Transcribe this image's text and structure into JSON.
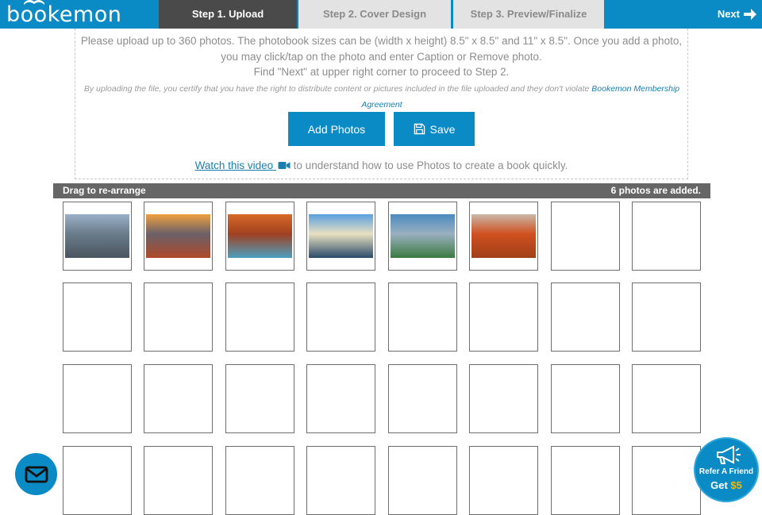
{
  "brand": {
    "logo_text": "bookemon"
  },
  "steps": [
    {
      "label": "Step 1. Upload",
      "active": true
    },
    {
      "label": "Step 2. Cover Design",
      "active": false
    },
    {
      "label": "Step 3. Preview/Finalize",
      "active": false
    }
  ],
  "next_label": "Next",
  "instructions": {
    "line1": "Please upload up to 360 photos. The photobook sizes can be (width x height) 8.5\" x 8.5\" and 11\" x 8.5\". Once you add a photo,",
    "line2": "you may click/tap on the photo and enter Caption or Remove photo.",
    "line3": "Find \"Next\" at upper right corner to proceed to Step 2.",
    "cert_text": "By uploading the file, you certify that you have the right to distribute content or pictures included in the file uploaded and they don't violate ",
    "cert_link_1": "Bookemon Membership",
    "cert_link_2": "Agreement"
  },
  "buttons": {
    "add_photos": "Add Photos",
    "save": "Save"
  },
  "video": {
    "link_text": "Watch this video",
    "rest": " to understand how to use Photos to create a book quickly."
  },
  "drag_bar": {
    "left": "Drag to re-arrange",
    "right": "6 photos are added."
  },
  "photos": [
    {
      "name": "lake-mountains",
      "colors": [
        "#9ab0c8",
        "#4a5560",
        "#6a7c8a"
      ]
    },
    {
      "name": "sunset-mountains",
      "colors": [
        "#f0a040",
        "#b04a2a",
        "#6a6068"
      ]
    },
    {
      "name": "winding-road",
      "colors": [
        "#d86a28",
        "#4aa0c0",
        "#a04020"
      ]
    },
    {
      "name": "fjord-village",
      "colors": [
        "#5aa0e0",
        "#2a4a6a",
        "#e8e0c0"
      ]
    },
    {
      "name": "river-valley",
      "colors": [
        "#4a8ac0",
        "#3a7a40",
        "#9ab0c0"
      ]
    },
    {
      "name": "autumn-forest",
      "colors": [
        "#c8b8a8",
        "#a04018",
        "#d05020"
      ]
    }
  ],
  "refer": {
    "line1": "Refer A Friend",
    "line2_prefix": "Get ",
    "amount": "$5"
  },
  "icons": {
    "next": "arrow-right-icon",
    "save": "floppy-disk-icon",
    "video": "video-camera-icon",
    "mail": "envelope-icon",
    "refer": "megaphone-icon"
  },
  "colors": {
    "brand_blue": "#0a8bc6",
    "active_tab": "#4a4a4a",
    "inactive_tab": "#e3e3e3",
    "drag_bar": "#666666",
    "link": "#1a7fae",
    "accent_yellow": "#f5b800"
  }
}
